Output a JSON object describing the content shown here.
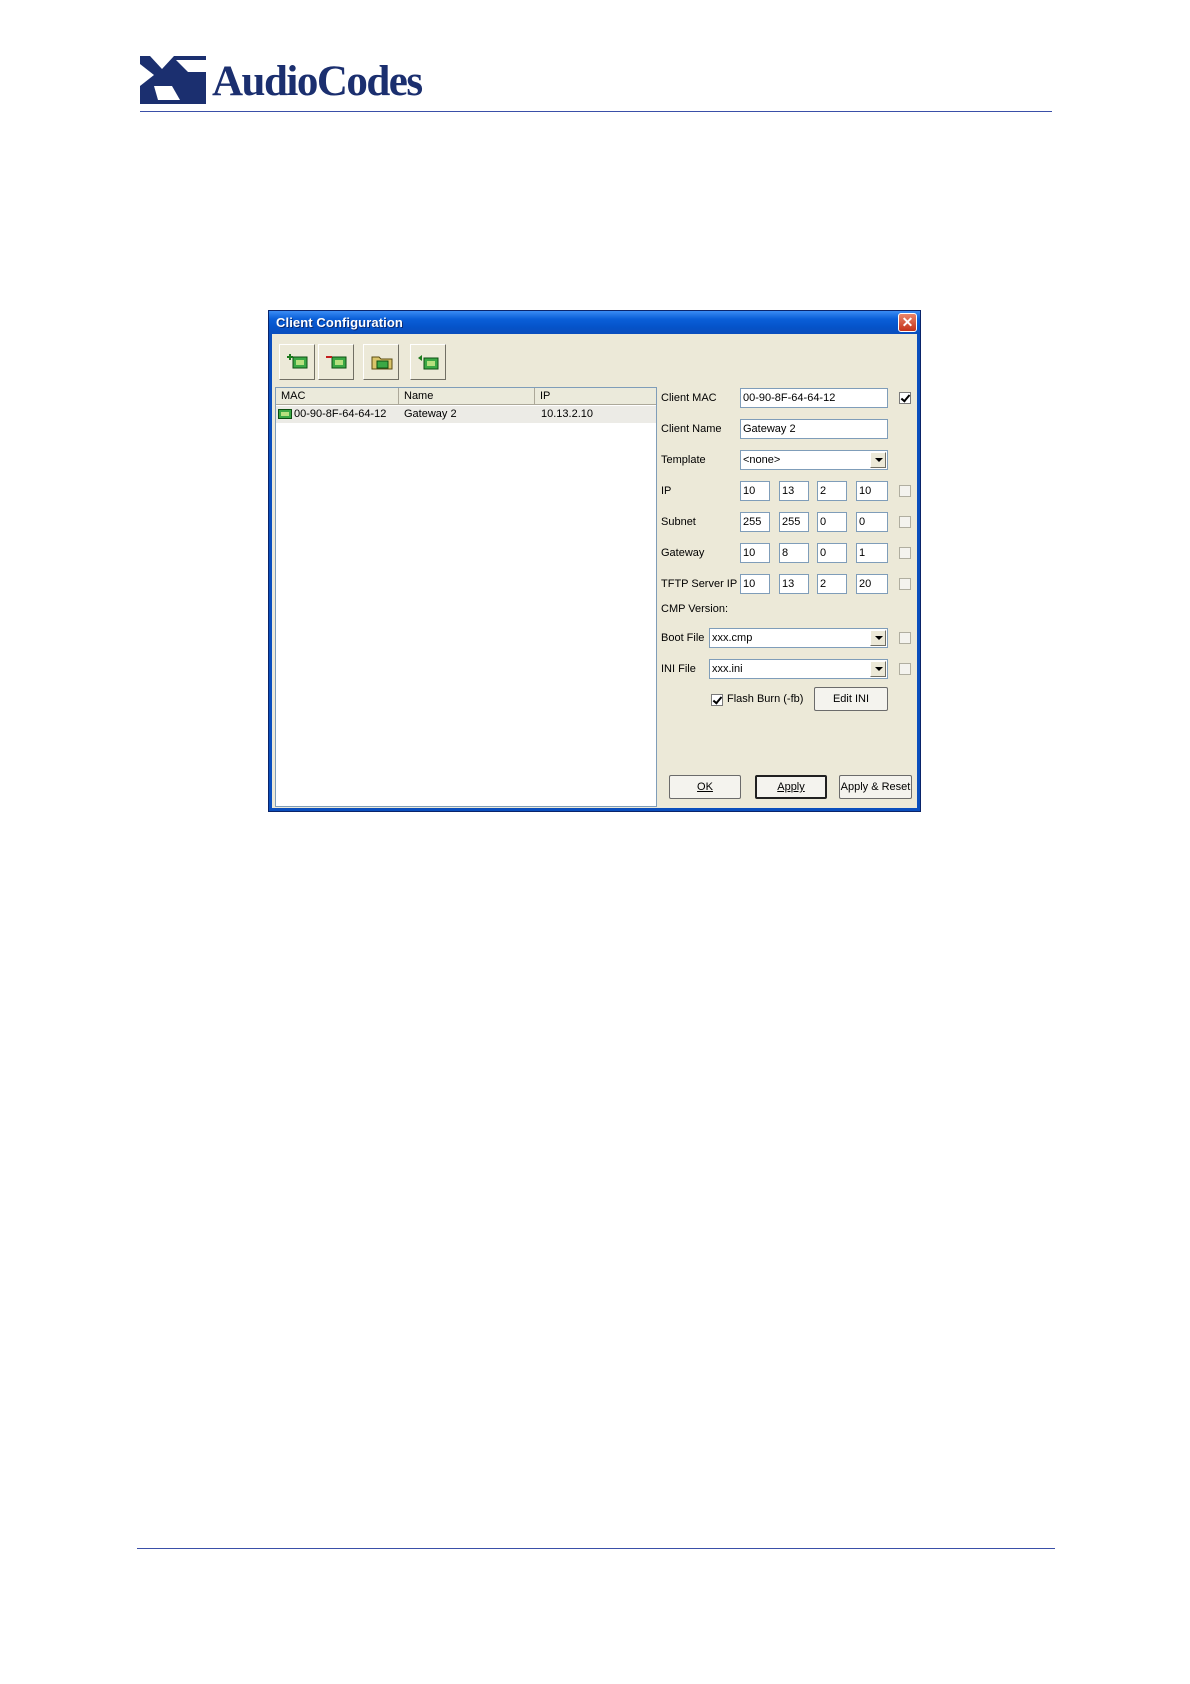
{
  "page": {
    "logo_text": "AudioCodes"
  },
  "dialog": {
    "title": "Client Configuration",
    "close_label": "✕",
    "toolbar": [
      "add-client-icon",
      "remove-client-icon",
      "open-folder-icon",
      "apply-client-icon"
    ],
    "list": {
      "columns": [
        "MAC",
        "Name",
        "IP"
      ],
      "rows": [
        {
          "mac": "00-90-8F-64-64-12",
          "name": "Gateway 2",
          "ip": "10.13.2.10"
        }
      ]
    },
    "form": {
      "client_mac_label": "Client MAC",
      "client_mac": "00-90-8F-64-64-12",
      "client_name_label": "Client Name",
      "client_name": "Gateway 2",
      "template_label": "Template",
      "template": "<none>",
      "ip_label": "IP",
      "ip": [
        "10",
        "13",
        "2",
        "10"
      ],
      "subnet_label": "Subnet",
      "subnet": [
        "255",
        "255",
        "0",
        "0"
      ],
      "gateway_label": "Gateway",
      "gateway": [
        "10",
        "8",
        "0",
        "1"
      ],
      "tftp_label": "TFTP Server IP",
      "tftp": [
        "10",
        "13",
        "2",
        "20"
      ],
      "cmp_version_label": "CMP Version:",
      "boot_file_label": "Boot File",
      "boot_file": "xxx.cmp",
      "ini_file_label": "INI File",
      "ini_file": "xxx.ini",
      "flash_burn_label": "Flash Burn (-fb)",
      "flash_burn_checked": true,
      "client_mac_checked": true
    },
    "buttons": {
      "edit_ini": "Edit INI",
      "ok": "OK",
      "apply": "Apply",
      "apply_reset": "Apply & Reset"
    }
  }
}
